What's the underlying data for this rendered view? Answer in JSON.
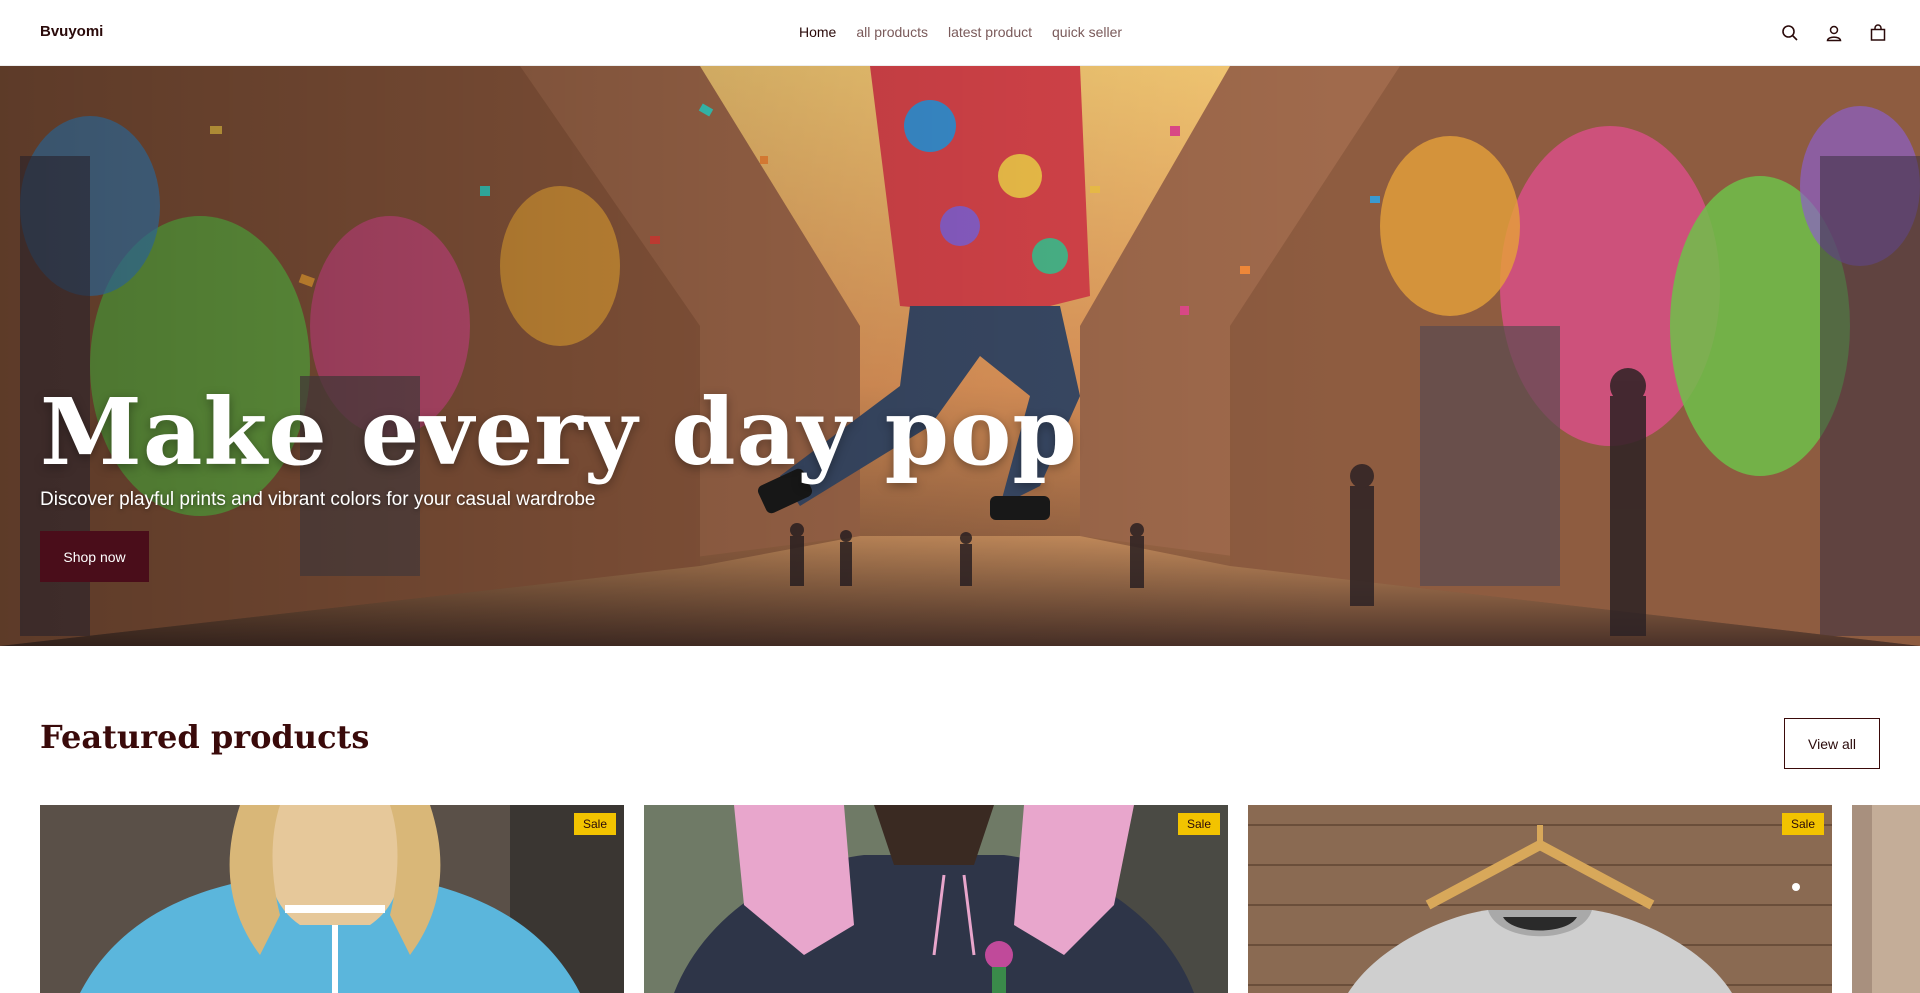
{
  "header": {
    "brand": "Bvuyomi",
    "nav": [
      {
        "label": "Home",
        "active": true
      },
      {
        "label": "all products",
        "active": false
      },
      {
        "label": "latest product",
        "active": false
      },
      {
        "label": "quick seller",
        "active": false
      }
    ],
    "icons": [
      "search-icon",
      "account-icon",
      "cart-icon"
    ]
  },
  "hero": {
    "title": "Make every day pop",
    "subtitle": "Discover playful prints and vibrant colors for your casual wardrobe",
    "cta_label": "Shop now"
  },
  "featured": {
    "title": "Featured products",
    "view_all_label": "View all",
    "cards": [
      {
        "badge": "Sale"
      },
      {
        "badge": "Sale"
      },
      {
        "badge": "Sale"
      }
    ]
  },
  "colors": {
    "brand_dark": "#4a0d1a",
    "sale_badge": "#f2c300",
    "heading": "#3a0a0a"
  }
}
